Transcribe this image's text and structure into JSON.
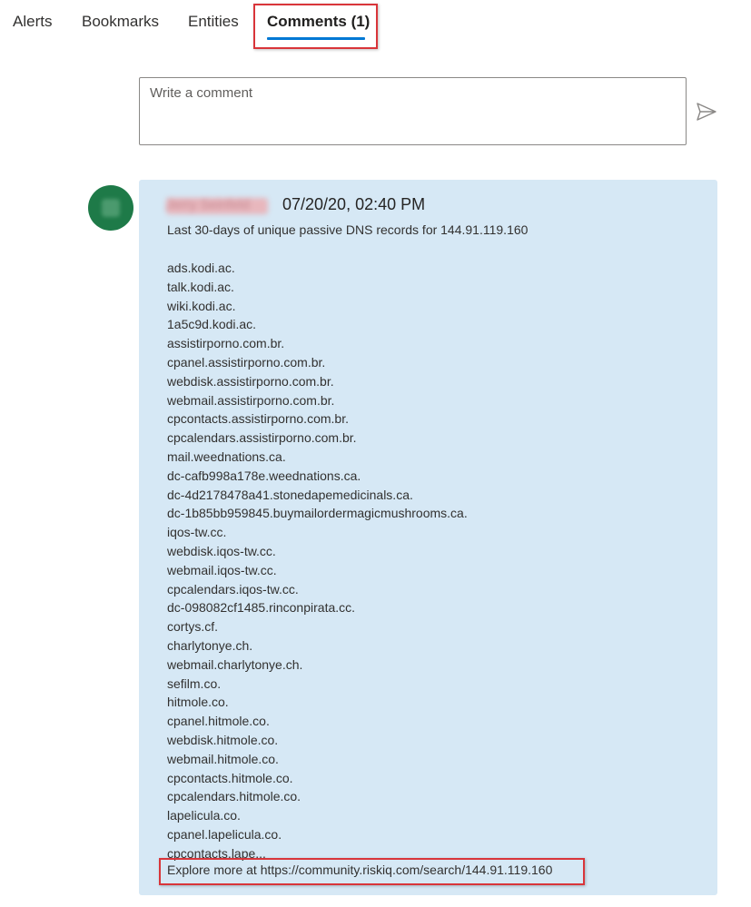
{
  "tabs": [
    {
      "label": "Alerts"
    },
    {
      "label": "Bookmarks"
    },
    {
      "label": "Entities"
    },
    {
      "label": "Comments (1)",
      "active": true
    }
  ],
  "comment_input": {
    "placeholder": "Write a comment",
    "value": ""
  },
  "comment": {
    "author": "Jerry Seinfeld",
    "timestamp": "07/20/20, 02:40 PM",
    "summary": "Last 30-days of unique passive DNS records for 144.91.119.160",
    "records": [
      "ads.kodi.ac.",
      "talk.kodi.ac.",
      "wiki.kodi.ac.",
      "1a5c9d.kodi.ac.",
      "assistirporno.com.br.",
      "cpanel.assistirporno.com.br.",
      "webdisk.assistirporno.com.br.",
      "webmail.assistirporno.com.br.",
      "cpcontacts.assistirporno.com.br.",
      "cpcalendars.assistirporno.com.br.",
      "mail.weednations.ca.",
      "dc-cafb998a178e.weednations.ca.",
      "dc-4d2178478a41.stonedapemedicinals.ca.",
      "dc-1b85bb959845.buymailordermagicmushrooms.ca.",
      "iqos-tw.cc.",
      "webdisk.iqos-tw.cc.",
      "webmail.iqos-tw.cc.",
      "cpcalendars.iqos-tw.cc.",
      "dc-098082cf1485.rinconpirata.cc.",
      "cortys.cf.",
      "charlytonye.ch.",
      "webmail.charlytonye.ch.",
      "sefilm.co.",
      "hitmole.co.",
      "cpanel.hitmole.co.",
      "webdisk.hitmole.co.",
      "webmail.hitmole.co.",
      "cpcontacts.hitmole.co.",
      "cpcalendars.hitmole.co.",
      "lapelicula.co.",
      "cpanel.lapelicula.co.",
      "cpcontacts.lape..."
    ],
    "explore_prefix": "Explore more at ",
    "explore_url": "https://community.riskiq.com/search/144.91.119.160"
  },
  "colors": {
    "accent": "#0078d4",
    "card_background": "#d6e8f5",
    "avatar": "#1e7a48",
    "highlight_box": "#d9353a"
  },
  "icons": {
    "send": "send-icon"
  }
}
